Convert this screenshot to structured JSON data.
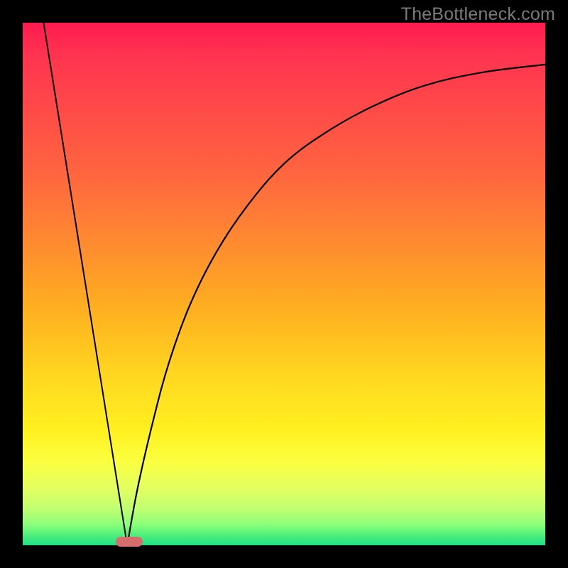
{
  "watermark": "TheBottleneck.com",
  "chart_data": {
    "type": "line",
    "title": "",
    "xlabel": "",
    "ylabel": "",
    "xlim": [
      0,
      100
    ],
    "ylim": [
      0,
      100
    ],
    "grid": false,
    "legend": null,
    "series": [
      {
        "name": "left-line",
        "x": [
          4,
          20
        ],
        "y": [
          100,
          0
        ]
      },
      {
        "name": "right-curve",
        "x": [
          20,
          22,
          25,
          28,
          32,
          37,
          43,
          50,
          58,
          67,
          77,
          88,
          100
        ],
        "y": [
          0,
          11,
          24,
          35,
          46,
          56,
          65,
          73,
          79,
          84,
          88,
          90.5,
          92
        ]
      }
    ],
    "marker": {
      "name": "bottleneck-marker",
      "x_center": 20.4,
      "y": 0,
      "width_pct": 5.2,
      "color": "#d66d6d"
    },
    "background_gradient": {
      "top": "#ff1a4f",
      "mid_upper": "#ff8a30",
      "mid": "#fff020",
      "bottom": "#1ee08a"
    }
  }
}
